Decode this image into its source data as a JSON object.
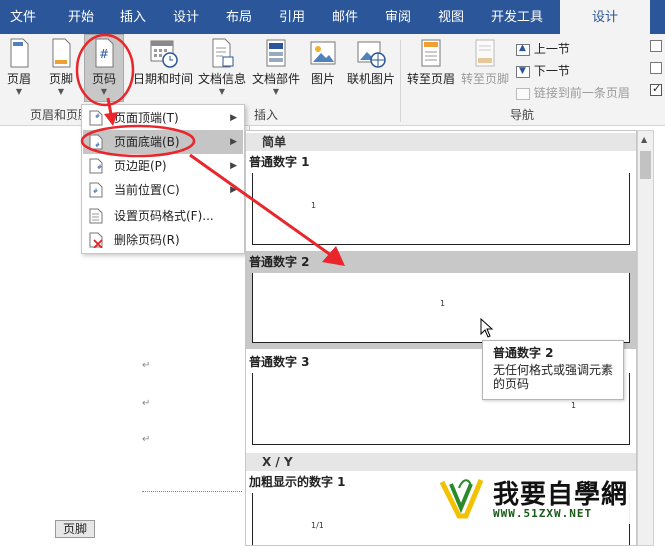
{
  "tabs": [
    {
      "label": "文件"
    },
    {
      "label": "开始"
    },
    {
      "label": "插入"
    },
    {
      "label": "设计"
    },
    {
      "label": "布局"
    },
    {
      "label": "引用"
    },
    {
      "label": "邮件"
    },
    {
      "label": "审阅"
    },
    {
      "label": "视图"
    },
    {
      "label": "开发工具"
    },
    {
      "label": "设计",
      "active": true
    }
  ],
  "ribbon": {
    "header_btn": "页眉",
    "footer_btn": "页脚",
    "pagenum_btn": "页码",
    "datetime_btn": "日期和时间",
    "docinfo_btn": "文档信息",
    "docparts_btn": "文档部件",
    "picture_btn": "图片",
    "online_picture_btn": "联机图片",
    "goto_header_btn": "转至页眉",
    "goto_footer_btn": "转至页脚",
    "prev_section": "上一节",
    "next_section": "下一节",
    "link_prev": "链接到前一条页眉",
    "group_headerfooter": "页眉和页脚",
    "group_insert": "插入",
    "group_nav": "导航"
  },
  "menu": {
    "items": [
      {
        "label": "页面顶端(T)",
        "submenu": true
      },
      {
        "label": "页面底端(B)",
        "submenu": true,
        "hover": true
      },
      {
        "label": "页边距(P)",
        "submenu": true
      },
      {
        "label": "当前位置(C)",
        "submenu": true
      },
      {
        "label": "设置页码格式(F)..."
      },
      {
        "label": "删除页码(R)"
      }
    ]
  },
  "gallery": {
    "section1": "简单",
    "items": [
      {
        "title": "普通数字 1",
        "mark": "1"
      },
      {
        "title": "普通数字 2",
        "mark": "1"
      },
      {
        "title": "普通数字 3",
        "mark": "1"
      }
    ],
    "section2": "X / Y",
    "bold_title": "加粗显示的数字 1",
    "bold_mark": "1/1"
  },
  "tooltip": {
    "title": "普通数字 2",
    "desc": "无任何格式或强调元素的页码"
  },
  "doc": {
    "footer_tag": "页脚",
    "para_mark": "↵"
  },
  "logo": {
    "text": "我要自學網",
    "url": "WWW.51ZXW.NET"
  },
  "colors": {
    "tabbar": "#2b579a",
    "annotation": "#e8262b",
    "menu_hover": "#c5c5c5",
    "gallery_selected": "#c8c8c8"
  }
}
